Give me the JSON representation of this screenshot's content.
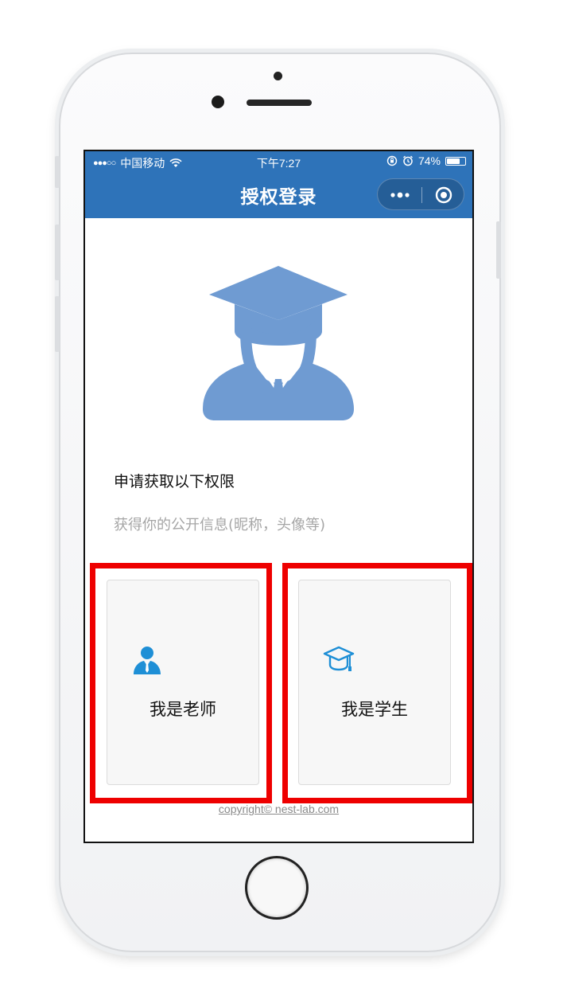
{
  "statusbar": {
    "signal": "●●●○○",
    "carrier": "中国移动",
    "time": "下午7:27",
    "battery": "74%",
    "battery_level": 0.74
  },
  "navbar": {
    "title": "授权登录"
  },
  "permissions": {
    "title": "申请获取以下权限",
    "description": "获得你的公开信息(昵称，头像等)"
  },
  "roles": {
    "teacher": {
      "label": "我是老师",
      "icon": "teacher-icon"
    },
    "student": {
      "label": "我是学生",
      "icon": "graduation-cap-icon"
    }
  },
  "footer": {
    "copyright": "copyright© nest-lab.com"
  },
  "colors": {
    "accent": "#2e73b9",
    "avatar": "#6f9bd2",
    "role_icon": "#1e8fd6",
    "highlight": "#ee0000"
  }
}
